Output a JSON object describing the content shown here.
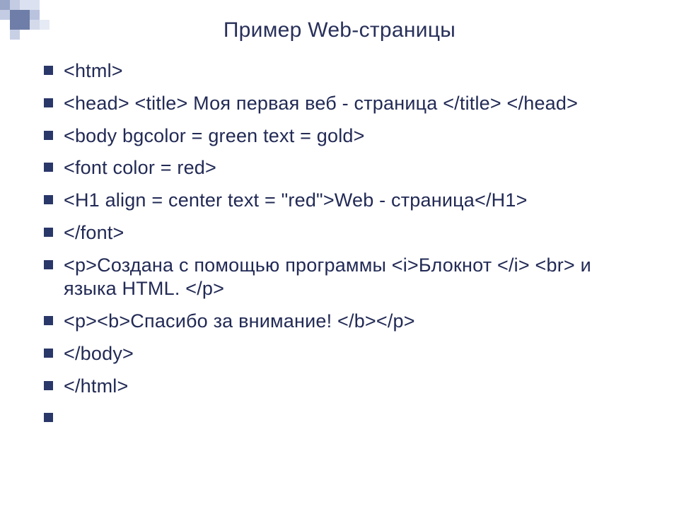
{
  "title": "Пример Web-страницы",
  "items": [
    "<html>",
    "<head> <title> Моя первая веб - страница </title> </head>",
    "<body bgcolor = green text = gold>",
    "<font color = red>",
    "<H1 align = center text = \"red\">Web - страница</H1>",
    "</font>",
    "<p>Создана с помощью программы <i>Блокнот </i> <br> и языка HTML. </p>",
    "<p><b>Спасибо за внимание! </b></p>",
    "</body>",
    "</html>",
    ""
  ]
}
